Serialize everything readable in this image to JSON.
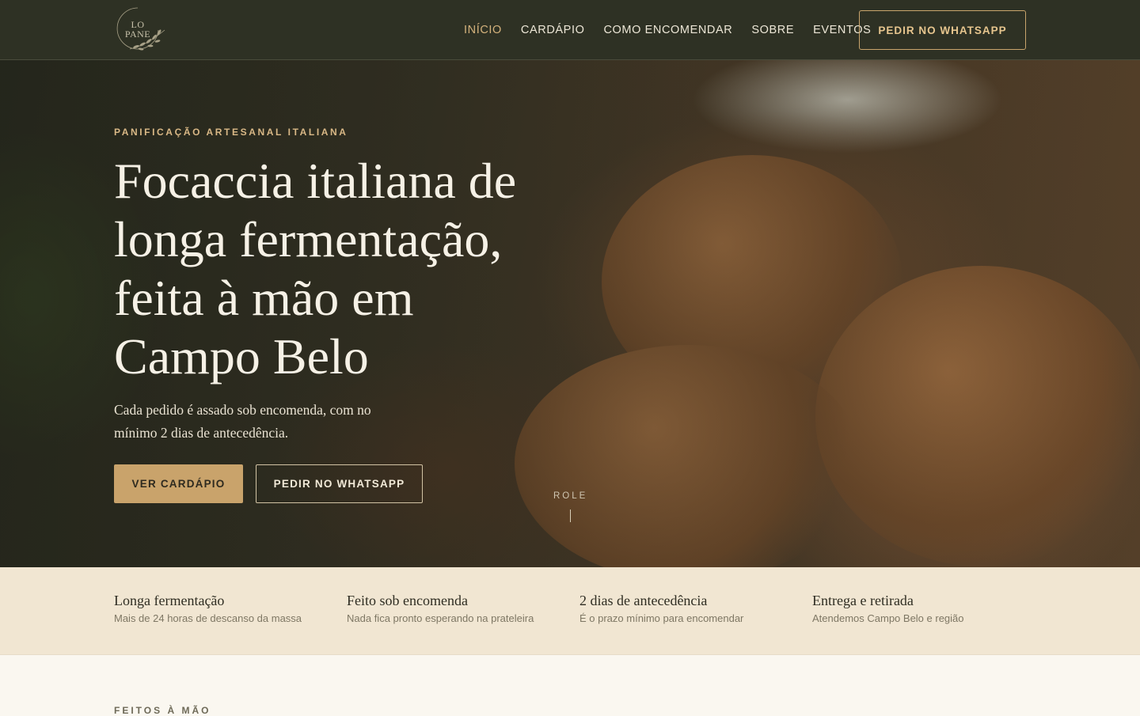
{
  "brand": {
    "logo_text": "LO PANE",
    "accent": "#c9a36b",
    "dark": "#2e3124"
  },
  "nav": {
    "items": [
      {
        "label": "INÍCIO",
        "active": true
      },
      {
        "label": "CARDÁPIO",
        "active": false
      },
      {
        "label": "COMO ENCOMENDAR",
        "active": false
      },
      {
        "label": "SOBRE",
        "active": false
      },
      {
        "label": "EVENTOS",
        "active": false
      }
    ],
    "cta_label": "PEDIR NO WHATSAPP"
  },
  "hero": {
    "eyebrow": "PANIFICAÇÃO ARTESANAL ITALIANA",
    "title": "Focaccia italiana de longa fermentação, feita à mão em Campo Belo",
    "subtitle": "Cada pedido é assado sob encomenda, com no mínimo 2 dias de antecedência.",
    "primary_button": "VER CARDÁPIO",
    "secondary_button": "PEDIR NO WHATSAPP",
    "scroll_hint": "ROLE"
  },
  "features": [
    {
      "title": "Longa fermentação",
      "description": "Mais de 24 horas de descanso da massa"
    },
    {
      "title": "Feito sob encomenda",
      "description": "Nada fica pronto esperando na prateleira"
    },
    {
      "title": "2 dias de antecedência",
      "description": "É o prazo mínimo para encomendar"
    },
    {
      "title": "Entrega e retirada",
      "description": "Atendemos Campo Belo e região"
    }
  ],
  "next_section": {
    "eyebrow": "FEITOS À MÃO"
  }
}
